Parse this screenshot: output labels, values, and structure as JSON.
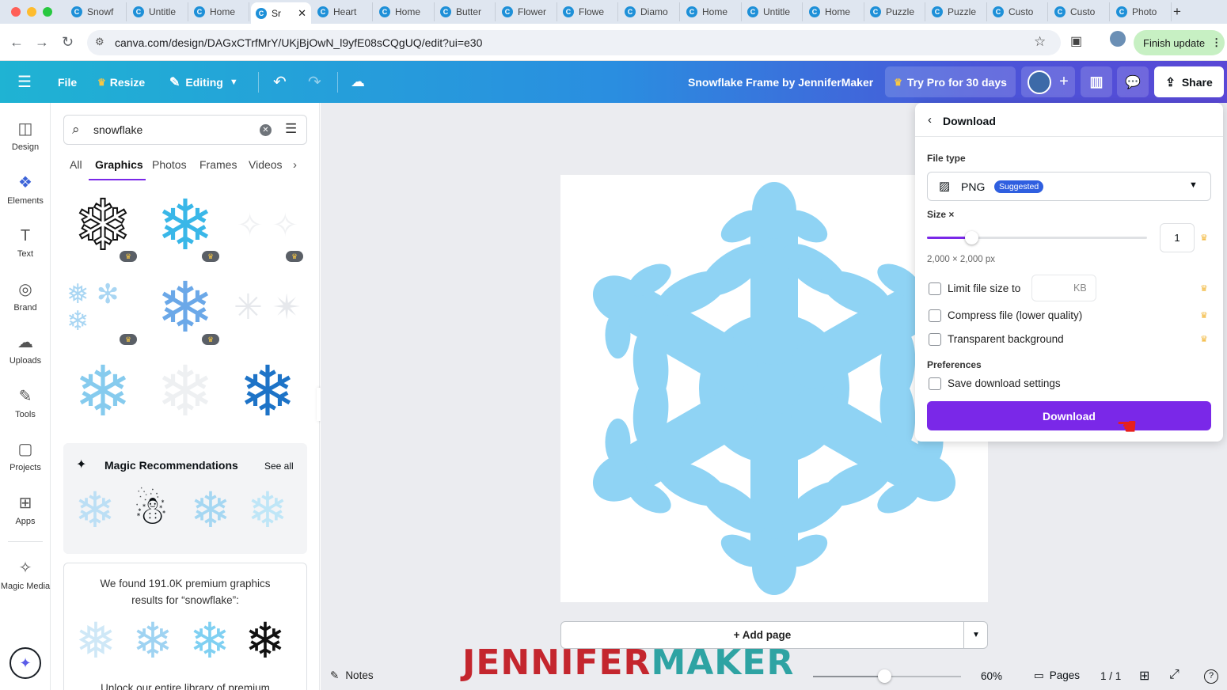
{
  "browser": {
    "tabs": [
      "Snowf",
      "Untitle",
      "Home",
      "Sr",
      "Heart",
      "Home",
      "Butter",
      "Flower",
      "Flowe",
      "Diamo",
      "Home",
      "Untitle",
      "Home",
      "Puzzle",
      "Puzzle",
      "Custo",
      "Custo",
      "Photo"
    ],
    "url": "canva.com/design/DAGxCTrfMrY/UKjBjOwN_l9yfE08sCQgUQ/edit?ui=e30",
    "finish_update": "Finish update"
  },
  "header": {
    "file": "File",
    "resize": "Resize",
    "editing": "Editing",
    "design_title": "Snowflake Frame by JenniferMaker",
    "try_pro": "Try Pro for 30 days",
    "share": "Share"
  },
  "rail": [
    {
      "label": "Design",
      "icon": "design-icon"
    },
    {
      "label": "Elements",
      "icon": "elements-icon"
    },
    {
      "label": "Text",
      "icon": "text-icon"
    },
    {
      "label": "Brand",
      "icon": "brand-icon"
    },
    {
      "label": "Uploads",
      "icon": "uploads-icon"
    },
    {
      "label": "Tools",
      "icon": "tools-icon"
    },
    {
      "label": "Projects",
      "icon": "projects-icon"
    },
    {
      "label": "Apps",
      "icon": "apps-icon"
    },
    {
      "label": "Magic Media",
      "icon": "magic-media-icon"
    }
  ],
  "panel": {
    "search_value": "snowflake",
    "tabs": [
      "All",
      "Graphics",
      "Photos",
      "Frames",
      "Videos"
    ],
    "active_tab": "Graphics",
    "magic_title": "Magic Recommendations",
    "see_all": "See all",
    "premium_line1": "We found 191.0K premium graphics",
    "premium_line2": "results for “snowflake”:",
    "premium_line3": "Unlock our entire library of premium"
  },
  "download": {
    "title": "Download",
    "file_type_label": "File type",
    "file_type": "PNG",
    "suggested": "Suggested",
    "size_label": "Size ×",
    "size_value": "1",
    "size_fraction": 0.2,
    "dimensions": "2,000 × 2,000 px",
    "limit_label": "Limit file size to",
    "limit_unit": "KB",
    "compress_label": "Compress file (lower quality)",
    "transparent_label": "Transparent background",
    "preferences_label": "Preferences",
    "save_label": "Save download settings",
    "button": "Download"
  },
  "canvas": {
    "add_page": "+ Add page",
    "accent_color": "#8fd3f4"
  },
  "footer": {
    "notes": "Notes",
    "zoom": "60%",
    "zoom_fraction": 0.48,
    "pages": "Pages",
    "page_count": "1 / 1"
  },
  "watermark": {
    "part1": "JENNIFER",
    "part2": "MAKER"
  }
}
